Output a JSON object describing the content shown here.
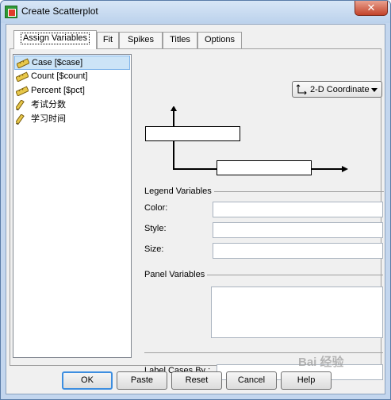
{
  "window": {
    "title": "Create Scatterplot",
    "close_glyph": "✕"
  },
  "tabs": [
    {
      "label": "Assign Variables",
      "active": true
    },
    {
      "label": "Fit",
      "active": false
    },
    {
      "label": "Spikes",
      "active": false
    },
    {
      "label": "Titles",
      "active": false
    },
    {
      "label": "Options",
      "active": false
    }
  ],
  "variables": [
    {
      "label": "Case [$case]",
      "icon": "ruler-icon",
      "selected": true
    },
    {
      "label": "Count [$count]",
      "icon": "ruler-icon",
      "selected": false
    },
    {
      "label": "Percent [$pct]",
      "icon": "ruler-icon",
      "selected": false
    },
    {
      "label": "考试分数",
      "icon": "pencil-ruler-icon",
      "selected": false
    },
    {
      "label": "学习时间",
      "icon": "pencil-ruler-icon",
      "selected": false
    }
  ],
  "coordinate": {
    "selected": "2-D Coordinate",
    "icon": "axes-icon"
  },
  "legend_variables": {
    "heading": "Legend Variables",
    "color_label": "Color:",
    "style_label": "Style:",
    "size_label": "Size:"
  },
  "panel_variables": {
    "heading": "Panel Variables"
  },
  "label_cases_by": "Label Cases By :",
  "buttons": {
    "ok": "OK",
    "paste": "Paste",
    "reset": "Reset",
    "cancel": "Cancel",
    "help": "Help"
  },
  "watermark": "Bai 经验"
}
